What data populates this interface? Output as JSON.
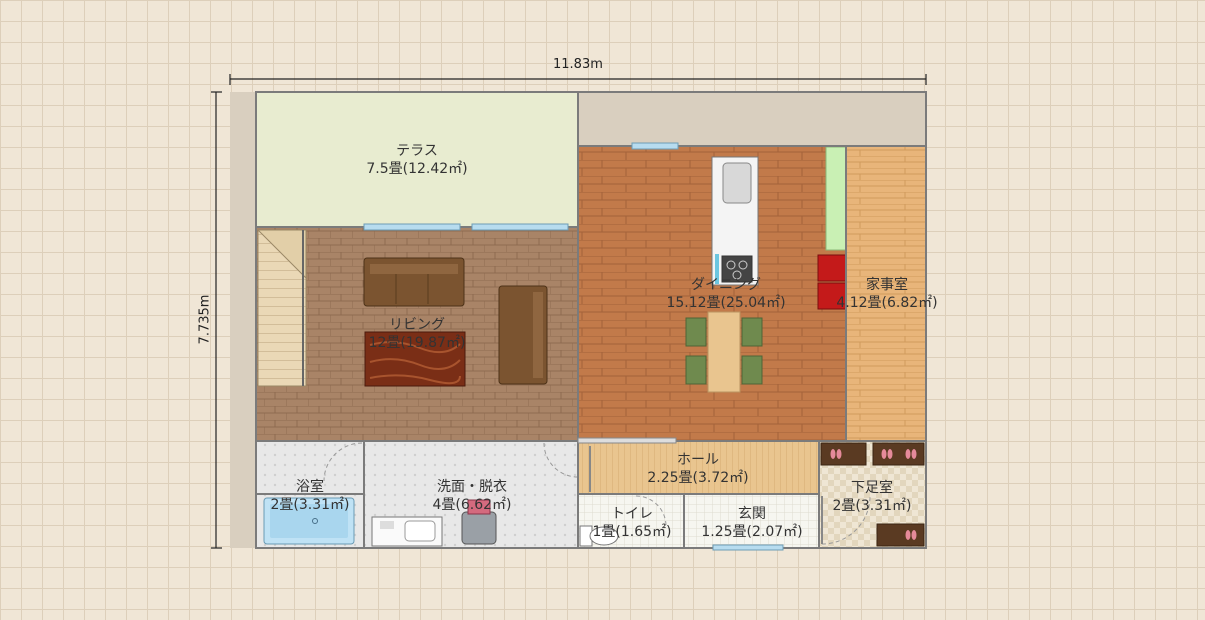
{
  "dimensions": {
    "width_label": "11.83m",
    "height_label": "7.735m"
  },
  "rooms": {
    "terrace": {
      "name": "テラス",
      "area": "7.5畳(12.42㎡)"
    },
    "living": {
      "name": "リビング",
      "area": "12畳(19.87㎡)"
    },
    "dining": {
      "name": "ダイニング",
      "area": "15.12畳(25.04㎡)"
    },
    "utility": {
      "name": "家事室",
      "area": "4.12畳(6.82㎡)"
    },
    "bath": {
      "name": "浴室",
      "area": "2畳(3.31㎡)"
    },
    "washroom": {
      "name": "洗面・脱衣",
      "area": "4畳(6.62㎡)"
    },
    "hall": {
      "name": "ホール",
      "area": "2.25畳(3.72㎡)"
    },
    "toilet": {
      "name": "トイレ",
      "area": "1畳(1.65㎡)"
    },
    "entrance": {
      "name": "玄関",
      "area": "1.25畳(2.07㎡)"
    },
    "shoe_room": {
      "name": "下足室",
      "area": "2畳(3.31㎡)"
    }
  },
  "colors": {
    "terrace": "#e8ecd0",
    "living_floor": "#a98467",
    "dining_floor": "#c27a4a",
    "utility_floor": "#e8b57a",
    "wall": "#7b7b7b",
    "outer_shade": "#d9cfbf"
  }
}
